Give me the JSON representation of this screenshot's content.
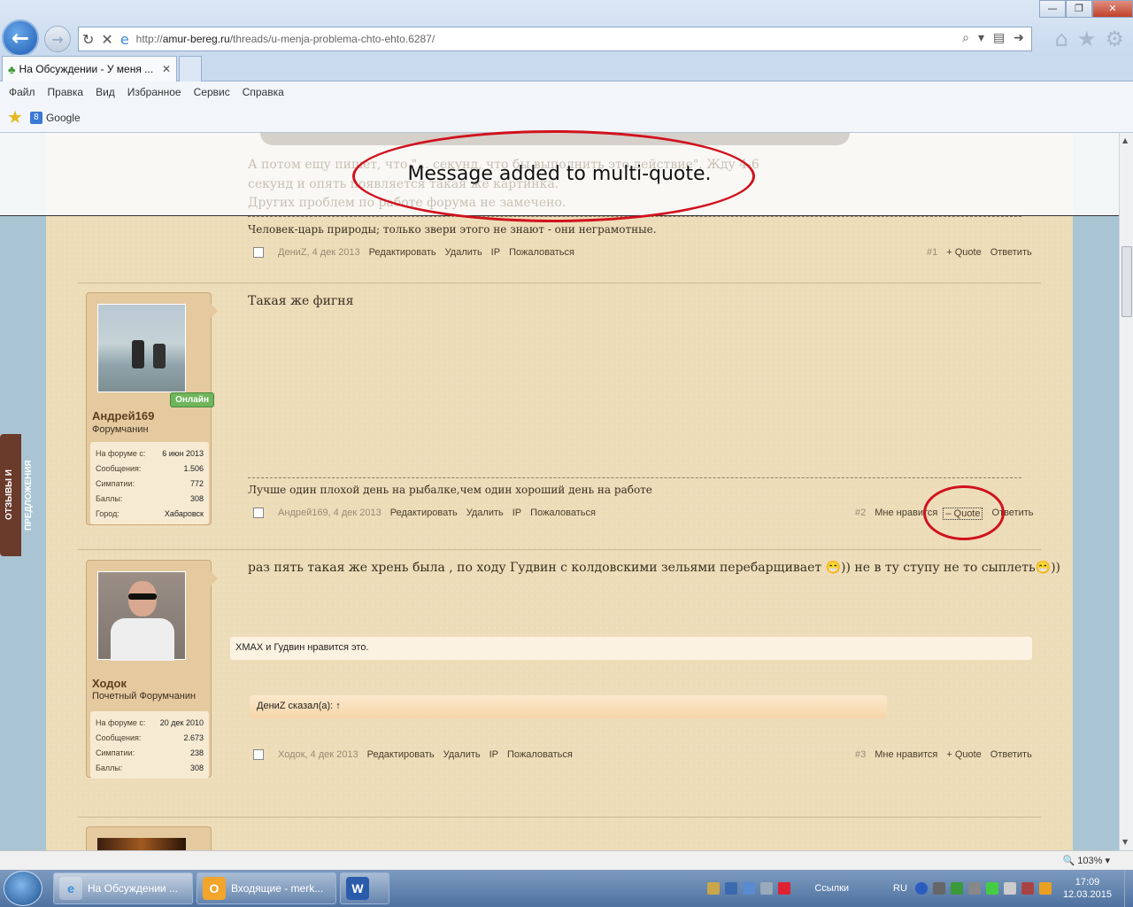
{
  "browser": {
    "url_prefix": "http://",
    "url_domain": "amur-bereg.ru",
    "url_path": "/threads/u-menja-problema-chto-ehto.6287/",
    "tab_title": "На Обсуждении - У меня ...",
    "menu": [
      "Файл",
      "Правка",
      "Вид",
      "Избранное",
      "Сервис",
      "Справка"
    ],
    "fav_google": "Google",
    "zoom": "103%"
  },
  "overlay": {
    "message": "Message added to multi-quote.",
    "ghost_line1": "А потом ещу пишет, что \"...                                                                         секунд, что бы выполнить это действие\". Жду 4-6",
    "ghost_line2": "секунд и опять появляется такая же картинка.",
    "ghost_line3": "Других проблем по работе форума не замечено."
  },
  "feedback_tab": "ОТЗЫВЫ И ПРЕДЛОЖЕНИЯ",
  "post1": {
    "signature": "Человек-царь природы; только звери этого не знают - они неграмотные.",
    "author_date": "ДениZ, 4 дек 2013",
    "actions": [
      "Редактировать",
      "Удалить",
      "IP",
      "Пожаловаться"
    ],
    "num": "#1",
    "quote": "+ Quote",
    "reply": "Ответить"
  },
  "post2": {
    "user": {
      "name": "Андрей169",
      "title": "Форумчанин",
      "online": "Онлайн",
      "stats": [
        {
          "label": "На форуме с:",
          "value": "6 июн 2013"
        },
        {
          "label": "Сообщения:",
          "value": "1.506"
        },
        {
          "label": "Симпатии:",
          "value": "772"
        },
        {
          "label": "Баллы:",
          "value": "308"
        },
        {
          "label": "Город:",
          "value": "Хабаровск"
        }
      ]
    },
    "text": "Такая же фигня",
    "signature": "Лучше один плохой день на рыбалке,чем один хороший день на работе",
    "author_date": "Андрей169, 4 дек 2013",
    "actions": [
      "Редактировать",
      "Удалить",
      "IP",
      "Пожаловаться"
    ],
    "num": "#2",
    "like": "Мне нравится",
    "quote": "– Quote",
    "reply": "Ответить"
  },
  "post3": {
    "user": {
      "name": "Ходок",
      "title": "Почетный Форумчанин",
      "stats": [
        {
          "label": "На форуме с:",
          "value": "20 дек 2010"
        },
        {
          "label": "Сообщения:",
          "value": "2.673"
        },
        {
          "label": "Симпатии:",
          "value": "238"
        },
        {
          "label": "Баллы:",
          "value": "308"
        }
      ]
    },
    "text": "раз пять такая же хрень была , по ходу Гудвин с колдовскими зельями перебарщивает 😁)) не в ту ступу не то сыплеть😁))",
    "author_date": "Ходок, 4 дек 2013",
    "actions": [
      "Редактировать",
      "Удалить",
      "IP",
      "Пожаловаться"
    ],
    "num": "#3",
    "like": "Мне нравится",
    "quote": "+ Quote",
    "reply": "Ответить",
    "likes_text": "XMAX и Гудвин нравится это."
  },
  "post4": {
    "quote_header": "ДениZ сказал(а): ↑"
  },
  "taskbar": {
    "tasks": [
      "На Обсуждении ...",
      "Входящие - merk..."
    ],
    "lang": "RU",
    "links": "Ссылки",
    "time": "17:09",
    "date": "12.03.2015"
  }
}
